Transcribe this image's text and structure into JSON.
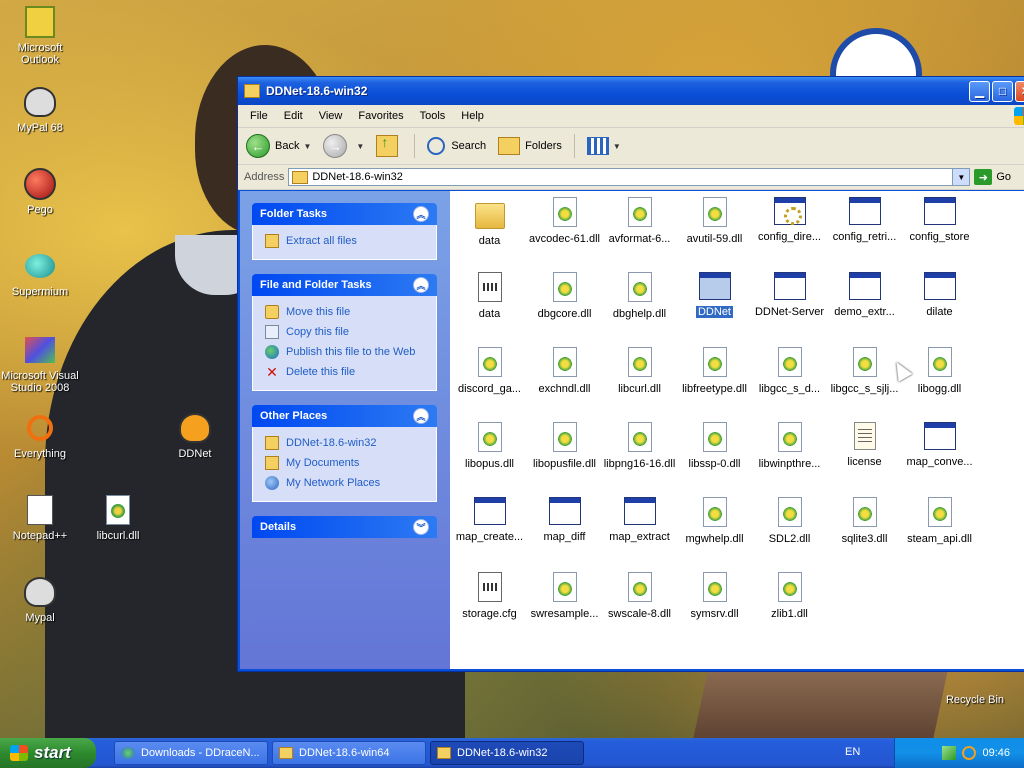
{
  "desktop": {
    "icons": [
      {
        "label": "Microsoft\nOutlook",
        "icon": "outlook-icon"
      },
      {
        "label": "MyPal 68",
        "icon": "mypal-icon"
      },
      {
        "label": "Pego",
        "icon": "pego-icon"
      },
      {
        "label": "Supermium",
        "icon": "supermium-icon"
      },
      {
        "label": "Microsoft Visual\nStudio 2008",
        "icon": "visual-studio-icon"
      },
      {
        "label": "Everything",
        "icon": "everything-icon"
      },
      {
        "label": "DDNet",
        "icon": "ddnet-icon"
      },
      {
        "label": "Notepad++",
        "icon": "notepadpp-icon"
      },
      {
        "label": "libcurl.dll",
        "icon": "dll-icon"
      },
      {
        "label": "Mypal",
        "icon": "mypal-icon"
      },
      {
        "label": "Recycle Bin",
        "icon": "recycle-bin-icon"
      }
    ]
  },
  "window": {
    "title": "DDNet-18.6-win32",
    "menu": [
      "File",
      "Edit",
      "View",
      "Favorites",
      "Tools",
      "Help"
    ],
    "toolbar": {
      "back": "Back",
      "search": "Search",
      "folders": "Folders"
    },
    "address": {
      "label": "Address",
      "value": "DDNet-18.6-win32",
      "go": "Go"
    },
    "taskpane": {
      "folder_tasks": {
        "title": "Folder Tasks",
        "items": [
          {
            "label": "Extract all files",
            "icon": "extract-icon"
          }
        ]
      },
      "file_folder_tasks": {
        "title": "File and Folder Tasks",
        "items": [
          {
            "label": "Move this file",
            "icon": "move-icon"
          },
          {
            "label": "Copy this file",
            "icon": "copy-icon"
          },
          {
            "label": "Publish this file to the Web",
            "icon": "globe-icon"
          },
          {
            "label": "Delete this file",
            "icon": "delete-icon"
          }
        ]
      },
      "other_places": {
        "title": "Other Places",
        "items": [
          {
            "label": "DDNet-18.6-win32",
            "icon": "folder-icon"
          },
          {
            "label": "My Documents",
            "icon": "my-documents-icon"
          },
          {
            "label": "My Network Places",
            "icon": "network-icon"
          }
        ]
      },
      "details": {
        "title": "Details"
      }
    },
    "files": [
      {
        "name": "data",
        "type": "folder"
      },
      {
        "name": "avcodec-61.dll",
        "type": "dll"
      },
      {
        "name": "avformat-6...",
        "type": "dll"
      },
      {
        "name": "avutil-59.dll",
        "type": "dll"
      },
      {
        "name": "config_dire...",
        "type": "gear"
      },
      {
        "name": "config_retri...",
        "type": "exe"
      },
      {
        "name": "config_store",
        "type": "exe"
      },
      {
        "name": "data",
        "type": "cfg"
      },
      {
        "name": "dbgcore.dll",
        "type": "dll"
      },
      {
        "name": "dbghelp.dll",
        "type": "dll"
      },
      {
        "name": "DDNet",
        "type": "exe",
        "selected": true
      },
      {
        "name": "DDNet-Server",
        "type": "exe"
      },
      {
        "name": "demo_extr...",
        "type": "exe"
      },
      {
        "name": "dilate",
        "type": "exe"
      },
      {
        "name": "discord_ga...",
        "type": "dll"
      },
      {
        "name": "exchndl.dll",
        "type": "dll"
      },
      {
        "name": "libcurl.dll",
        "type": "dll"
      },
      {
        "name": "libfreetype.dll",
        "type": "dll"
      },
      {
        "name": "libgcc_s_d...",
        "type": "dll"
      },
      {
        "name": "libgcc_s_sjlj...",
        "type": "dll"
      },
      {
        "name": "libogg.dll",
        "type": "dll"
      },
      {
        "name": "libopus.dll",
        "type": "dll"
      },
      {
        "name": "libopusfile.dll",
        "type": "dll"
      },
      {
        "name": "libpng16-16.dll",
        "type": "dll"
      },
      {
        "name": "libssp-0.dll",
        "type": "dll"
      },
      {
        "name": "libwinpthre...",
        "type": "dll"
      },
      {
        "name": "license",
        "type": "txt"
      },
      {
        "name": "map_conve...",
        "type": "exe"
      },
      {
        "name": "map_create...",
        "type": "exe"
      },
      {
        "name": "map_diff",
        "type": "exe"
      },
      {
        "name": "map_extract",
        "type": "exe"
      },
      {
        "name": "mgwhelp.dll",
        "type": "dll"
      },
      {
        "name": "SDL2.dll",
        "type": "dll"
      },
      {
        "name": "sqlite3.dll",
        "type": "dll"
      },
      {
        "name": "steam_api.dll",
        "type": "dll"
      },
      {
        "name": "storage.cfg",
        "type": "cfg"
      },
      {
        "name": "swresample...",
        "type": "dll"
      },
      {
        "name": "swscale-8.dll",
        "type": "dll"
      },
      {
        "name": "symsrv.dll",
        "type": "dll"
      },
      {
        "name": "zlib1.dll",
        "type": "dll"
      }
    ]
  },
  "taskbar": {
    "start": "start",
    "tasks": [
      {
        "label": "Downloads - DDraceN...",
        "icon": "browser-icon"
      },
      {
        "label": "DDNet-18.6-win64",
        "icon": "folder-icon"
      },
      {
        "label": "DDNet-18.6-win32",
        "icon": "folder-icon",
        "active": true
      }
    ],
    "lang": "EN",
    "clock": "09:46"
  }
}
